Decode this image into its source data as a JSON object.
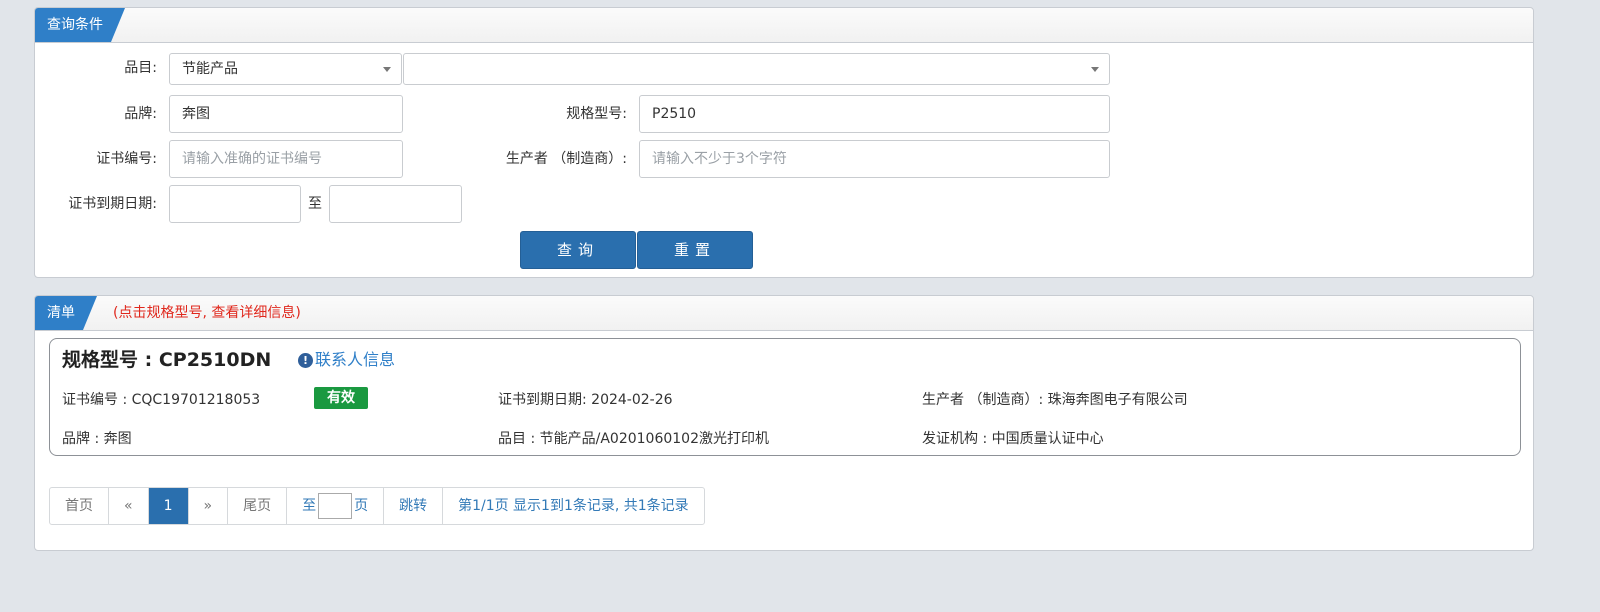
{
  "query": {
    "tab_label": "查询条件",
    "category_label": "品目:",
    "category_value": "节能产品",
    "subcategory_value": "",
    "brand_label": "品牌:",
    "brand_value": "奔图",
    "model_label": "规格型号:",
    "model_value": "P2510",
    "cert_no_label": "证书编号:",
    "cert_no_placeholder": "请输入准确的证书编号",
    "manufacturer_label": "生产者 （制造商）:",
    "manufacturer_placeholder": "请输入不少于3个字符",
    "expiry_label": "证书到期日期:",
    "expiry_sep": "至",
    "expiry_from": "",
    "expiry_to": "",
    "search_button": "查询",
    "reset_button": "重置"
  },
  "list": {
    "tab_label": "清单",
    "note": "(点击规格型号, 查看详细信息)",
    "items": [
      {
        "title": "规格型号 : CP2510DN",
        "contact_icon": "exclamation-circle-icon",
        "contact_label": "联系人信息",
        "cert_no": "证书编号 : CQC19701218053",
        "status": "有效",
        "expiry": "证书到期日期: 2024-02-26",
        "manufacturer": "生产者 （制造商）: 珠海奔图电子有限公司",
        "brand": "品牌 : 奔图",
        "category": "品目 : 节能产品/A0201060102激光打印机",
        "issuer": "发证机构 : 中国质量认证中心"
      }
    ]
  },
  "pager": {
    "first": "首页",
    "prev": "«",
    "current": "1",
    "next": "»",
    "last": "尾页",
    "goto_prefix": "至",
    "goto_value": "",
    "goto_suffix": "页",
    "jump": "跳转",
    "summary": "第1/1页  显示1到1条记录, 共1条记录"
  },
  "colors": {
    "accent": "#2f7fc8",
    "button": "#2a6fae",
    "status_valid": "#1a9940",
    "note_red": "#e0281d"
  }
}
